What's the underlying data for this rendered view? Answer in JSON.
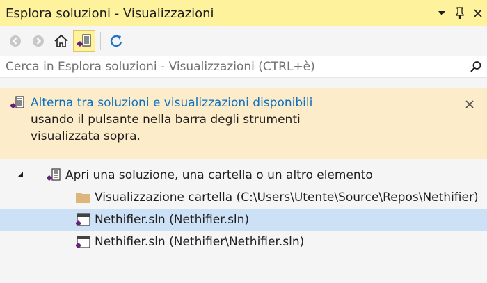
{
  "titlebar": {
    "title": "Esplora soluzioni - Visualizzazioni",
    "buttons": {
      "dropdown": "▾",
      "pin": "⊥",
      "close": "✕"
    }
  },
  "toolbar": {
    "icons": [
      "back-icon",
      "forward-icon",
      "home-icon",
      "switch-views-icon",
      "refresh-icon"
    ]
  },
  "search": {
    "placeholder": "Cerca in Esplora soluzioni - Visualizzazioni (CTRL+è)"
  },
  "info": {
    "link_text": "Alterna tra soluzioni e visualizzazioni disponibili",
    "line2": "usando il pulsante nella barra degli strumenti",
    "line3": "visualizzata sopra.",
    "close": "✕"
  },
  "tree": {
    "root": {
      "label": "Apri una soluzione, una cartella o un altro elemento",
      "expander": "◢"
    },
    "items": [
      {
        "label": "Visualizzazione cartella (C:\\Users\\Utente\\Source\\Repos\\Nethifier)",
        "icon": "folder-icon"
      },
      {
        "label": "Nethifier.sln (Nethifier.sln)",
        "icon": "solution-icon",
        "selected": true
      },
      {
        "label": "Nethifier.sln (Nethifier\\Nethifier.sln)",
        "icon": "solution-icon"
      }
    ]
  },
  "colors": {
    "title_bg": "#fff29d",
    "info_bg": "#fcecc9",
    "link": "#0e70c0",
    "selection": "#cce0f6"
  }
}
